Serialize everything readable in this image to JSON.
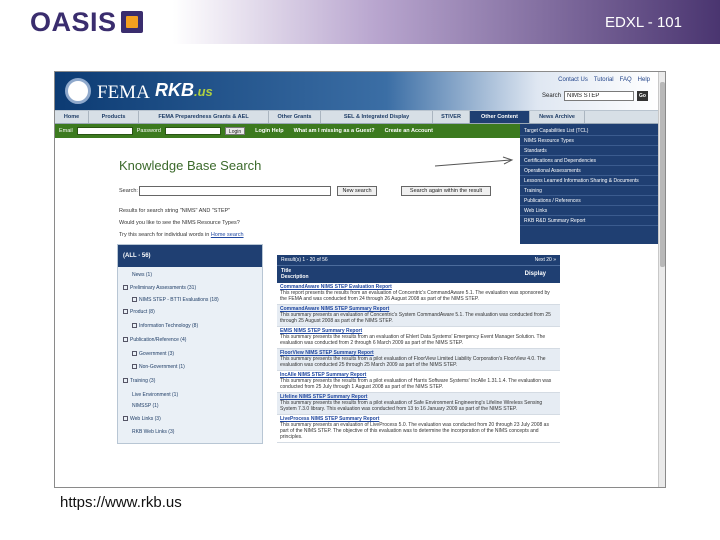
{
  "slide": {
    "title": "EDXL - 101",
    "logo_text": "OASIS",
    "url": "https://www.rkb.us"
  },
  "banner": {
    "agency": "FEMA",
    "site_logo": "RKB",
    "site_logo_suffix": ".us",
    "util_links": [
      "Contact Us",
      "Tutorial",
      "FAQ",
      "Help"
    ],
    "search_label": "Search",
    "search_value": "NIMS STEP",
    "go_label": "Go"
  },
  "nav": {
    "tabs": [
      "Home",
      "Products",
      "FEMA Preparedness Grants & AEL",
      "Other Grants",
      "SEL & Integrated Display",
      "STIVER",
      "Other Content",
      "News Archive"
    ],
    "active_index": 6
  },
  "login": {
    "email_label": "Email",
    "password_label": "Password",
    "go_label": "Login",
    "help_link": "Login Help",
    "guest_link": "What am I missing as a Guest?",
    "create_link": "Create an Account"
  },
  "dropdown": {
    "items": [
      "Target Capabilities List (TCL)",
      "NIMS Resource Types",
      "Standards",
      "Certifications and Dependencies",
      "Operational Assessments",
      "Lessons Learned Information Sharing & Documents",
      "Training",
      "Publications / References",
      "Web Links",
      "RKB R&D Summary Report"
    ]
  },
  "kb": {
    "title": "Knowledge Base Search",
    "search_label": "Search:",
    "new_search": "New search",
    "search_within": "Search again within the result",
    "results_for": "Results for search string \"NIMS\" AND \"STEP\"",
    "question": "Would you like to see the NIMS Resource Types?",
    "try_prefix": "Try this search for individual words in ",
    "try_link": "Home search"
  },
  "facets": {
    "header": "(ALL - 56)",
    "items": [
      {
        "label": "News (1)",
        "indent": 1,
        "toggle": false
      },
      {
        "label": "Preliminary Assessments (31)",
        "indent": 0,
        "toggle": true
      },
      {
        "label": "NIMS STEP - BTTI Evaluations (18)",
        "indent": 1,
        "toggle": true
      },
      {
        "label": "Product (8)",
        "indent": 0,
        "toggle": true
      },
      {
        "label": "Information Technology (8)",
        "indent": 1,
        "toggle": true
      },
      {
        "label": "Publication/Reference (4)",
        "indent": 0,
        "toggle": true
      },
      {
        "label": "Government (3)",
        "indent": 1,
        "toggle": true
      },
      {
        "label": "Non-Government (1)",
        "indent": 1,
        "toggle": true
      },
      {
        "label": "Training (3)",
        "indent": 0,
        "toggle": true
      },
      {
        "label": "Live Environment (1)",
        "indent": 1,
        "toggle": false
      },
      {
        "label": "NIMSSP (1)",
        "indent": 1,
        "toggle": false
      },
      {
        "label": "Web Links (3)",
        "indent": 0,
        "toggle": true
      },
      {
        "label": "RKB Web Links (3)",
        "indent": 1,
        "toggle": false
      }
    ]
  },
  "results": {
    "count": "Result(s) 1 - 20 of 56",
    "next": "Next 20 »",
    "col_title": "Title",
    "col_desc": "Description",
    "col_display": "Display",
    "items": [
      {
        "title": "CommandAware NIMS STEP Evaluation Report",
        "desc": "This report presents the results from an evaluation of Concentric's CommandAware 5.1. The evaluation was sponsored by the FEMA and was conducted from 24 through 26 August 2008 as part of the NIMS STEP."
      },
      {
        "title": "CommandAware NIMS STEP Summary Report",
        "desc": "This summary presents an evaluation of Concentric's System CommandAware 5.1. The evaluation was conducted from 25 through 25 August 2008 as part of the NIMS STEP."
      },
      {
        "title": "EMIS NIMS STEP Summary Report",
        "desc": "This summary presents the results from an evaluation of Ehlert Data Systems' Emergency Event Manager Solution. The evaluation was conducted from 2 through 6 March 2009 as part of the NIMS STEP."
      },
      {
        "title": "FloorView NIMS STEP Summary Report",
        "desc": "This summary presents the results from a pilot evaluation of FloorView Limited Liability Corporation's FloorView 4.0. The evaluation was conducted 25 through 25 March 2009 as part of the NIMS STEP."
      },
      {
        "title": "IncAlle NIMS STEP Summary Report",
        "desc": "This summary presents the results from a pilot evaluation of Harris Software Systems' IncAlle 1.31.1.4. The evaluation was conducted from 25 July through 1 August 2008 as part of the NIMS STEP."
      },
      {
        "title": "Lifeline NIMS STEP Summary Report",
        "desc": "This summary presents the results from a pilot evaluation of Safe Environment Engineering's Lifeline Wireless Sensing System 7.3.0 library. This evaluation was conducted from 13 to 16 January 2009 as part of the NIMS STEP."
      },
      {
        "title": "LiveProcess NIMS STEP Summary Report",
        "desc": "This summary presents an evaluation of LiveProcess 5.0. The evaluation was conducted from 20 through 23 July 2008 as part of the NIMS STEP. The objective of this evaluation was to determine the incorporation of the NIMS concepts and principles."
      }
    ]
  }
}
